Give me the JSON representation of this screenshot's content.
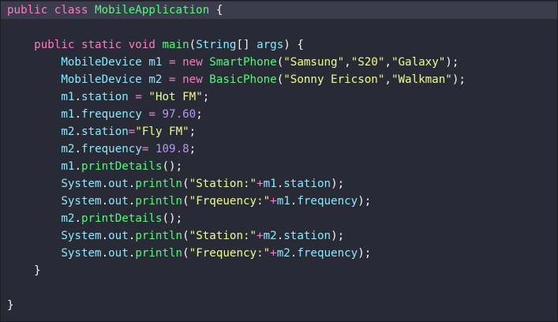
{
  "theme": {
    "background": "#282a36",
    "highlight": "#3b3d4c",
    "keyword": "#ff79c6",
    "type": "#8be9fd",
    "function": "#50fa7b",
    "string": "#f1fa8c",
    "number": "#bd93f9",
    "text": "#f8f8f2"
  },
  "code": {
    "lines": [
      {
        "highlight": true,
        "indent": 0,
        "tokens": [
          {
            "t": "kw",
            "v": "public"
          },
          {
            "t": "plain",
            "v": " "
          },
          {
            "t": "kw",
            "v": "class"
          },
          {
            "t": "plain",
            "v": " "
          },
          {
            "t": "fn",
            "v": "MobileApplication"
          },
          {
            "t": "plain",
            "v": " {"
          }
        ]
      },
      {
        "indent": 0,
        "tokens": []
      },
      {
        "indent": 4,
        "tokens": [
          {
            "t": "kw",
            "v": "public"
          },
          {
            "t": "plain",
            "v": " "
          },
          {
            "t": "kw",
            "v": "static"
          },
          {
            "t": "plain",
            "v": " "
          },
          {
            "t": "kw",
            "v": "void"
          },
          {
            "t": "plain",
            "v": " "
          },
          {
            "t": "fn",
            "v": "main"
          },
          {
            "t": "plain",
            "v": "("
          },
          {
            "t": "cls",
            "v": "String"
          },
          {
            "t": "plain",
            "v": "[] "
          },
          {
            "t": "cls",
            "v": "args"
          },
          {
            "t": "plain",
            "v": ") {"
          }
        ]
      },
      {
        "indent": 8,
        "tokens": [
          {
            "t": "cls",
            "v": "MobileDevice"
          },
          {
            "t": "plain",
            "v": " "
          },
          {
            "t": "id",
            "v": "m1"
          },
          {
            "t": "plain",
            "v": " "
          },
          {
            "t": "op",
            "v": "="
          },
          {
            "t": "plain",
            "v": " "
          },
          {
            "t": "kw",
            "v": "new"
          },
          {
            "t": "plain",
            "v": " "
          },
          {
            "t": "fn",
            "v": "SmartPhone"
          },
          {
            "t": "plain",
            "v": "("
          },
          {
            "t": "str",
            "v": "\"Samsung\""
          },
          {
            "t": "plain",
            "v": ","
          },
          {
            "t": "str",
            "v": "\"S20\""
          },
          {
            "t": "plain",
            "v": ","
          },
          {
            "t": "str",
            "v": "\"Galaxy\""
          },
          {
            "t": "plain",
            "v": ");"
          }
        ]
      },
      {
        "indent": 8,
        "tokens": [
          {
            "t": "cls",
            "v": "MobileDevice"
          },
          {
            "t": "plain",
            "v": " "
          },
          {
            "t": "id",
            "v": "m2"
          },
          {
            "t": "plain",
            "v": " "
          },
          {
            "t": "op",
            "v": "="
          },
          {
            "t": "plain",
            "v": " "
          },
          {
            "t": "kw",
            "v": "new"
          },
          {
            "t": "plain",
            "v": " "
          },
          {
            "t": "fn",
            "v": "BasicPhone"
          },
          {
            "t": "plain",
            "v": "("
          },
          {
            "t": "str",
            "v": "\"Sonny Ericson\""
          },
          {
            "t": "plain",
            "v": ","
          },
          {
            "t": "str",
            "v": "\"Walkman\""
          },
          {
            "t": "plain",
            "v": ");"
          }
        ]
      },
      {
        "indent": 8,
        "tokens": [
          {
            "t": "id",
            "v": "m1"
          },
          {
            "t": "plain",
            "v": "."
          },
          {
            "t": "id",
            "v": "station"
          },
          {
            "t": "plain",
            "v": " "
          },
          {
            "t": "op",
            "v": "="
          },
          {
            "t": "plain",
            "v": " "
          },
          {
            "t": "str",
            "v": "\"Hot FM\""
          },
          {
            "t": "plain",
            "v": ";"
          }
        ]
      },
      {
        "indent": 8,
        "tokens": [
          {
            "t": "id",
            "v": "m1"
          },
          {
            "t": "plain",
            "v": "."
          },
          {
            "t": "id",
            "v": "frequency"
          },
          {
            "t": "plain",
            "v": " "
          },
          {
            "t": "op",
            "v": "="
          },
          {
            "t": "plain",
            "v": " "
          },
          {
            "t": "num",
            "v": "97.60"
          },
          {
            "t": "plain",
            "v": ";"
          }
        ]
      },
      {
        "indent": 8,
        "tokens": [
          {
            "t": "id",
            "v": "m2"
          },
          {
            "t": "plain",
            "v": "."
          },
          {
            "t": "id",
            "v": "station"
          },
          {
            "t": "op",
            "v": "="
          },
          {
            "t": "str",
            "v": "\"Fly FM\""
          },
          {
            "t": "plain",
            "v": ";"
          }
        ]
      },
      {
        "indent": 8,
        "tokens": [
          {
            "t": "id",
            "v": "m2"
          },
          {
            "t": "plain",
            "v": "."
          },
          {
            "t": "id",
            "v": "frequency"
          },
          {
            "t": "op",
            "v": "="
          },
          {
            "t": "plain",
            "v": " "
          },
          {
            "t": "num",
            "v": "109.8"
          },
          {
            "t": "plain",
            "v": ";"
          }
        ]
      },
      {
        "indent": 8,
        "tokens": [
          {
            "t": "id",
            "v": "m1"
          },
          {
            "t": "plain",
            "v": "."
          },
          {
            "t": "fn",
            "v": "printDetails"
          },
          {
            "t": "plain",
            "v": "();"
          }
        ]
      },
      {
        "indent": 8,
        "tokens": [
          {
            "t": "cls",
            "v": "System"
          },
          {
            "t": "plain",
            "v": "."
          },
          {
            "t": "id",
            "v": "out"
          },
          {
            "t": "plain",
            "v": "."
          },
          {
            "t": "fn",
            "v": "println"
          },
          {
            "t": "plain",
            "v": "("
          },
          {
            "t": "str",
            "v": "\"Station:\""
          },
          {
            "t": "op",
            "v": "+"
          },
          {
            "t": "id",
            "v": "m1"
          },
          {
            "t": "plain",
            "v": "."
          },
          {
            "t": "id",
            "v": "station"
          },
          {
            "t": "plain",
            "v": ");"
          }
        ]
      },
      {
        "indent": 8,
        "tokens": [
          {
            "t": "cls",
            "v": "System"
          },
          {
            "t": "plain",
            "v": "."
          },
          {
            "t": "id",
            "v": "out"
          },
          {
            "t": "plain",
            "v": "."
          },
          {
            "t": "fn",
            "v": "println"
          },
          {
            "t": "plain",
            "v": "("
          },
          {
            "t": "str",
            "v": "\"Frqeuency:\""
          },
          {
            "t": "op",
            "v": "+"
          },
          {
            "t": "id",
            "v": "m1"
          },
          {
            "t": "plain",
            "v": "."
          },
          {
            "t": "id",
            "v": "frequency"
          },
          {
            "t": "plain",
            "v": ");"
          }
        ]
      },
      {
        "indent": 8,
        "tokens": [
          {
            "t": "id",
            "v": "m2"
          },
          {
            "t": "plain",
            "v": "."
          },
          {
            "t": "fn",
            "v": "printDetails"
          },
          {
            "t": "plain",
            "v": "();"
          }
        ]
      },
      {
        "indent": 8,
        "tokens": [
          {
            "t": "cls",
            "v": "System"
          },
          {
            "t": "plain",
            "v": "."
          },
          {
            "t": "id",
            "v": "out"
          },
          {
            "t": "plain",
            "v": "."
          },
          {
            "t": "fn",
            "v": "println"
          },
          {
            "t": "plain",
            "v": "("
          },
          {
            "t": "str",
            "v": "\"Station:\""
          },
          {
            "t": "op",
            "v": "+"
          },
          {
            "t": "id",
            "v": "m2"
          },
          {
            "t": "plain",
            "v": "."
          },
          {
            "t": "id",
            "v": "station"
          },
          {
            "t": "plain",
            "v": ");"
          }
        ]
      },
      {
        "indent": 8,
        "tokens": [
          {
            "t": "cls",
            "v": "System"
          },
          {
            "t": "plain",
            "v": "."
          },
          {
            "t": "id",
            "v": "out"
          },
          {
            "t": "plain",
            "v": "."
          },
          {
            "t": "fn",
            "v": "println"
          },
          {
            "t": "plain",
            "v": "("
          },
          {
            "t": "str",
            "v": "\"Frequency:\""
          },
          {
            "t": "op",
            "v": "+"
          },
          {
            "t": "id",
            "v": "m2"
          },
          {
            "t": "plain",
            "v": "."
          },
          {
            "t": "id",
            "v": "frequency"
          },
          {
            "t": "plain",
            "v": ");"
          }
        ]
      },
      {
        "indent": 4,
        "tokens": [
          {
            "t": "plain",
            "v": "}"
          }
        ]
      },
      {
        "indent": 0,
        "tokens": []
      },
      {
        "indent": 0,
        "tokens": [
          {
            "t": "plain",
            "v": "}"
          }
        ]
      }
    ]
  }
}
